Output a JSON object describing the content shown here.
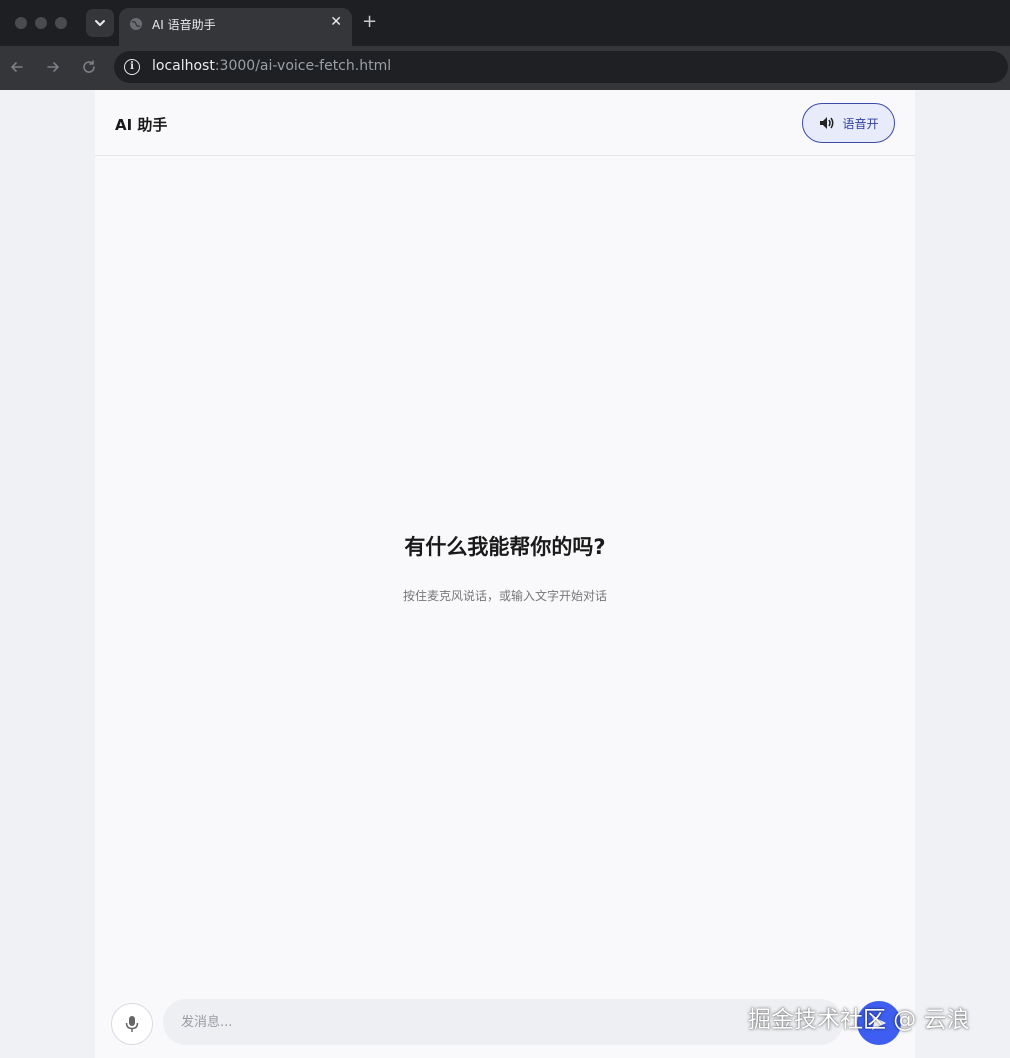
{
  "browser": {
    "tab_title": "AI 语音助手",
    "tab_close": "✕",
    "new_tab": "+",
    "url_host": "localhost",
    "url_path": ":3000/ai-voice-fetch.html",
    "icons": {
      "back": "arrow-left-icon",
      "forward": "arrow-right-icon",
      "reload": "reload-icon",
      "info": "info-icon",
      "tab_menu": "chevron-down-icon",
      "globe": "globe-icon"
    }
  },
  "header": {
    "title": "AI 助手",
    "voice_toggle_label": "语音开",
    "voice_toggle_icon": "speaker-icon"
  },
  "main": {
    "welcome_title": "有什么我能帮你的吗?",
    "welcome_subtitle": "按住麦克风说话，或输入文字开始对话"
  },
  "composer": {
    "placeholder": "发消息...",
    "mic_icon": "microphone-icon",
    "send_icon": "send-icon"
  },
  "watermark": "掘金技术社区 @ 云浪",
  "colors": {
    "accent": "#3d5ef0",
    "toggle_border": "#3b4ba8",
    "toggle_bg": "#e8ebfa",
    "app_bg": "#f9f9fb",
    "chrome_dark": "#1e1f22"
  }
}
